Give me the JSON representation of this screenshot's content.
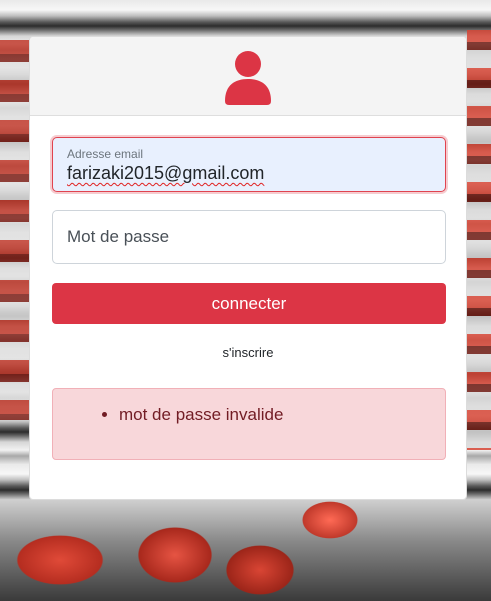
{
  "login": {
    "email": {
      "label": "Adresse email",
      "value": "farizaki2015@gmail.com"
    },
    "password": {
      "placeholder": "Mot de passe",
      "value": ""
    },
    "submit_label": "connecter",
    "register_label": "s'inscrire"
  },
  "alert": {
    "errors": [
      "mot de passe invalide"
    ]
  },
  "icons": {
    "header": "user-icon"
  },
  "colors": {
    "accent": "#dc3545",
    "alert_bg": "#f8d7da",
    "alert_text": "#721c24",
    "autofill_bg": "#e8f0fe"
  }
}
